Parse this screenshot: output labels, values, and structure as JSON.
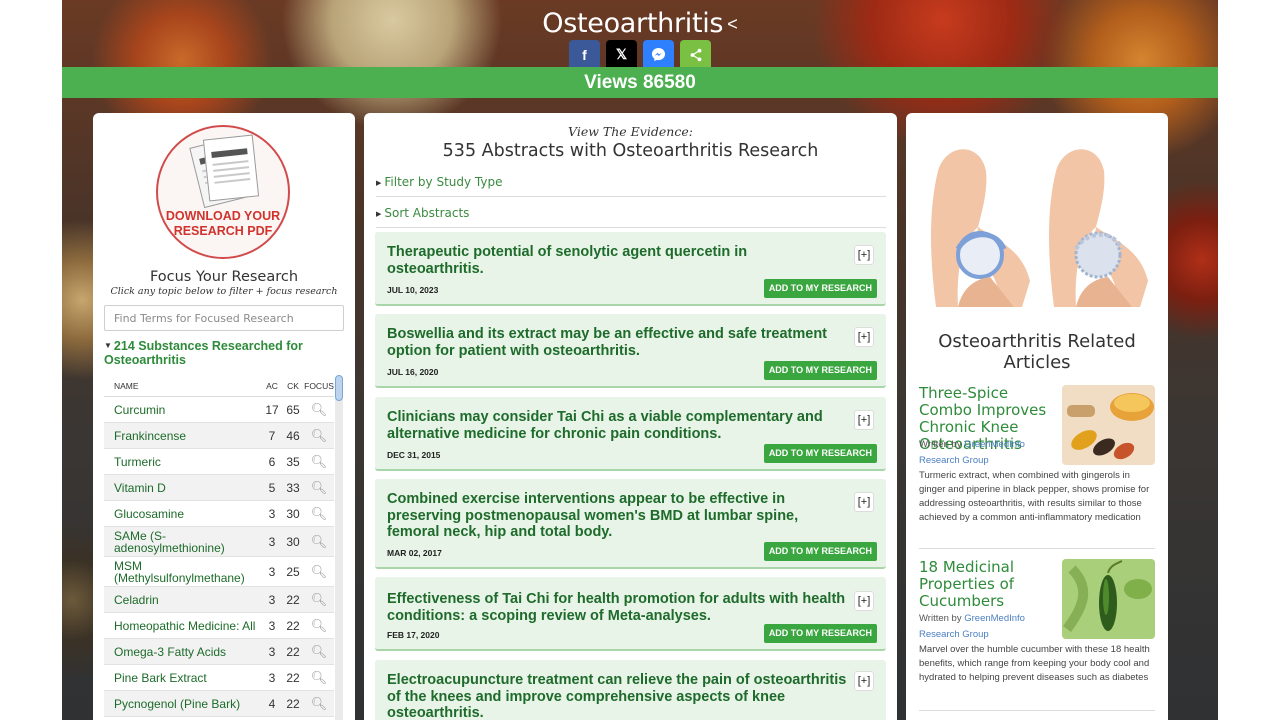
{
  "header": {
    "title": "Osteoarthritis",
    "views": "Views 86580"
  },
  "share": {
    "facebook": "f",
    "x": "𝕏",
    "messenger": "m",
    "share": "share"
  },
  "left": {
    "pdf_label": "DOWNLOAD YOUR RESEARCH PDF",
    "focus_title": "Focus Your Research",
    "focus_subtitle": "Click any topic below to filter + focus research",
    "search_placeholder": "Find Terms for Focused Research",
    "substances_heading": "214 Substances Researched for Osteoarthritis",
    "columns": {
      "name": "NAME",
      "ac": "AC",
      "ck": "CK",
      "focus": "FOCUS"
    },
    "substances": [
      {
        "name": "Curcumin",
        "ac": "17",
        "ck": "65"
      },
      {
        "name": "Frankincense",
        "ac": "7",
        "ck": "46"
      },
      {
        "name": "Turmeric",
        "ac": "6",
        "ck": "35"
      },
      {
        "name": "Vitamin D",
        "ac": "5",
        "ck": "33"
      },
      {
        "name": "Glucosamine",
        "ac": "3",
        "ck": "30"
      },
      {
        "name": "SAMe (S-adenosylmethionine)",
        "ac": "3",
        "ck": "30"
      },
      {
        "name": "MSM (Methylsulfonylmethane)",
        "ac": "3",
        "ck": "25"
      },
      {
        "name": "Celadrin",
        "ac": "3",
        "ck": "22"
      },
      {
        "name": "Homeopathic Medicine: All",
        "ac": "3",
        "ck": "22"
      },
      {
        "name": "Omega-3 Fatty Acids",
        "ac": "3",
        "ck": "22"
      },
      {
        "name": "Pine Bark Extract",
        "ac": "3",
        "ck": "22"
      },
      {
        "name": "Pycnogenol (Pine Bark)",
        "ac": "4",
        "ck": "22"
      }
    ]
  },
  "center": {
    "kicker": "View The Evidence:",
    "title": "535 Abstracts with Osteoarthritis Research",
    "filter_label": "Filter by Study Type",
    "sort_label": "Sort Abstracts",
    "expand_label": "[+]",
    "add_label": "ADD TO MY RESEARCH",
    "abstracts": [
      {
        "title": "Therapeutic potential of senolytic agent quercetin in osteoarthritis.",
        "date": "JUL 10, 2023"
      },
      {
        "title": "Boswellia and its extract may be an effective and safe treatment option for patient with osteoarthritis.",
        "date": "JUL 16, 2020"
      },
      {
        "title": "Clinicians may consider Tai Chi as a viable complementary and alternative medicine for chronic pain conditions.",
        "date": "DEC 31, 2015"
      },
      {
        "title": "Combined exercise interventions appear to be effective in preserving postmenopausal women's BMD at lumbar spine, femoral neck, hip and total body.",
        "date": "MAR 02, 2017"
      },
      {
        "title": "Effectiveness of Tai Chi for health promotion for adults with health conditions: a scoping review of Meta-analyses.",
        "date": "FEB 17, 2020"
      },
      {
        "title": "Electroacupuncture treatment can relieve the pain of osteoarthritis of the knees and improve comprehensive aspects of knee osteoarthritis.",
        "date": ""
      }
    ]
  },
  "right": {
    "related_title": "Osteoarthritis Related Articles",
    "articles": [
      {
        "title": "Three-Spice Combo Improves Chronic Knee Osteoarthritis",
        "written_by": "Written by ",
        "author": "GreenMedInfo Research Group",
        "description": "Turmeric extract, when combined with gingerols in ginger and piperine in black pepper, shows promise for addressing osteoarthritis, with results similar to those achieved by a common anti-inflammatory medication"
      },
      {
        "title": "18 Medicinal Properties of Cucumbers",
        "written_by": "Written by ",
        "author": "GreenMedInfo Research Group",
        "description": "Marvel over the humble cucumber with these 18 health benefits, which range from keeping your body cool and hydrated to helping prevent diseases such as diabetes"
      }
    ]
  }
}
